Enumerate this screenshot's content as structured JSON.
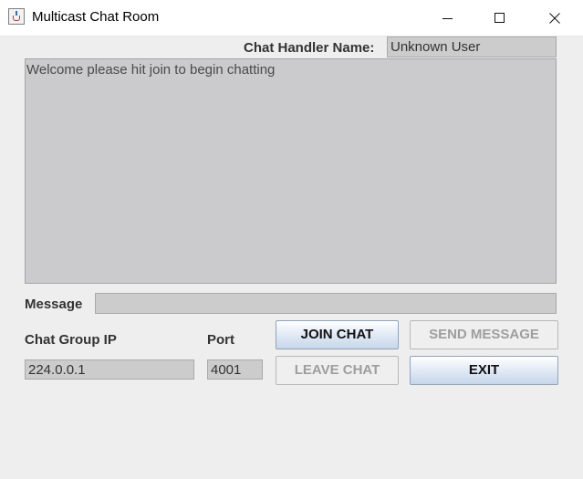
{
  "window": {
    "title": "Multicast Chat Room",
    "controls": [
      "minimize-icon",
      "maximize-icon",
      "close-icon"
    ]
  },
  "handler": {
    "label": "Chat Handler Name:",
    "value": "Unknown User"
  },
  "chat": {
    "text": "Welcome please hit join to begin chatting"
  },
  "message": {
    "label": "Message",
    "value": ""
  },
  "group": {
    "ip_label": "Chat Group IP",
    "ip_value": "224.0.0.1",
    "port_label": "Port",
    "port_value": "4001"
  },
  "buttons": {
    "join": "JOIN CHAT",
    "send": "SEND MESSAGE",
    "leave": "LEAVE CHAT",
    "exit": "EXIT"
  },
  "button_states": {
    "join": "enabled",
    "send": "disabled",
    "leave": "disabled",
    "exit": "enabled"
  },
  "colors": {
    "background": "#eeeeee",
    "field": "#cccccd",
    "button_gradient_end": "#c7d6ea",
    "disabled_text": "#9e9e9e"
  }
}
